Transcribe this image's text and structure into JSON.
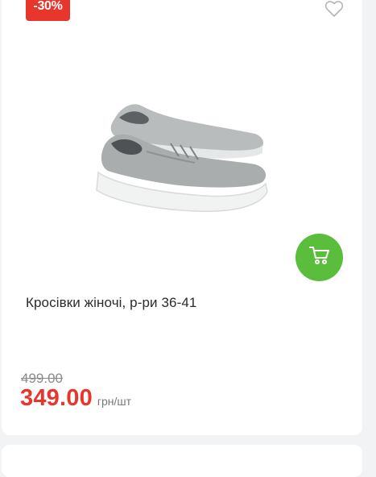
{
  "product": {
    "discount_badge": "-30%",
    "title": "Кросівки жіночі, р-ри 36-41",
    "old_price": "499.00",
    "price": "349.00",
    "unit": "грн/шт",
    "image_alt": "women's grey knit sneakers"
  },
  "icons": {
    "favorite": "heart-outline-icon",
    "cart": "cart-icon"
  },
  "colors": {
    "badge": "#e8362c",
    "price": "#e8362c",
    "cart_button": "#5bbd3c"
  }
}
